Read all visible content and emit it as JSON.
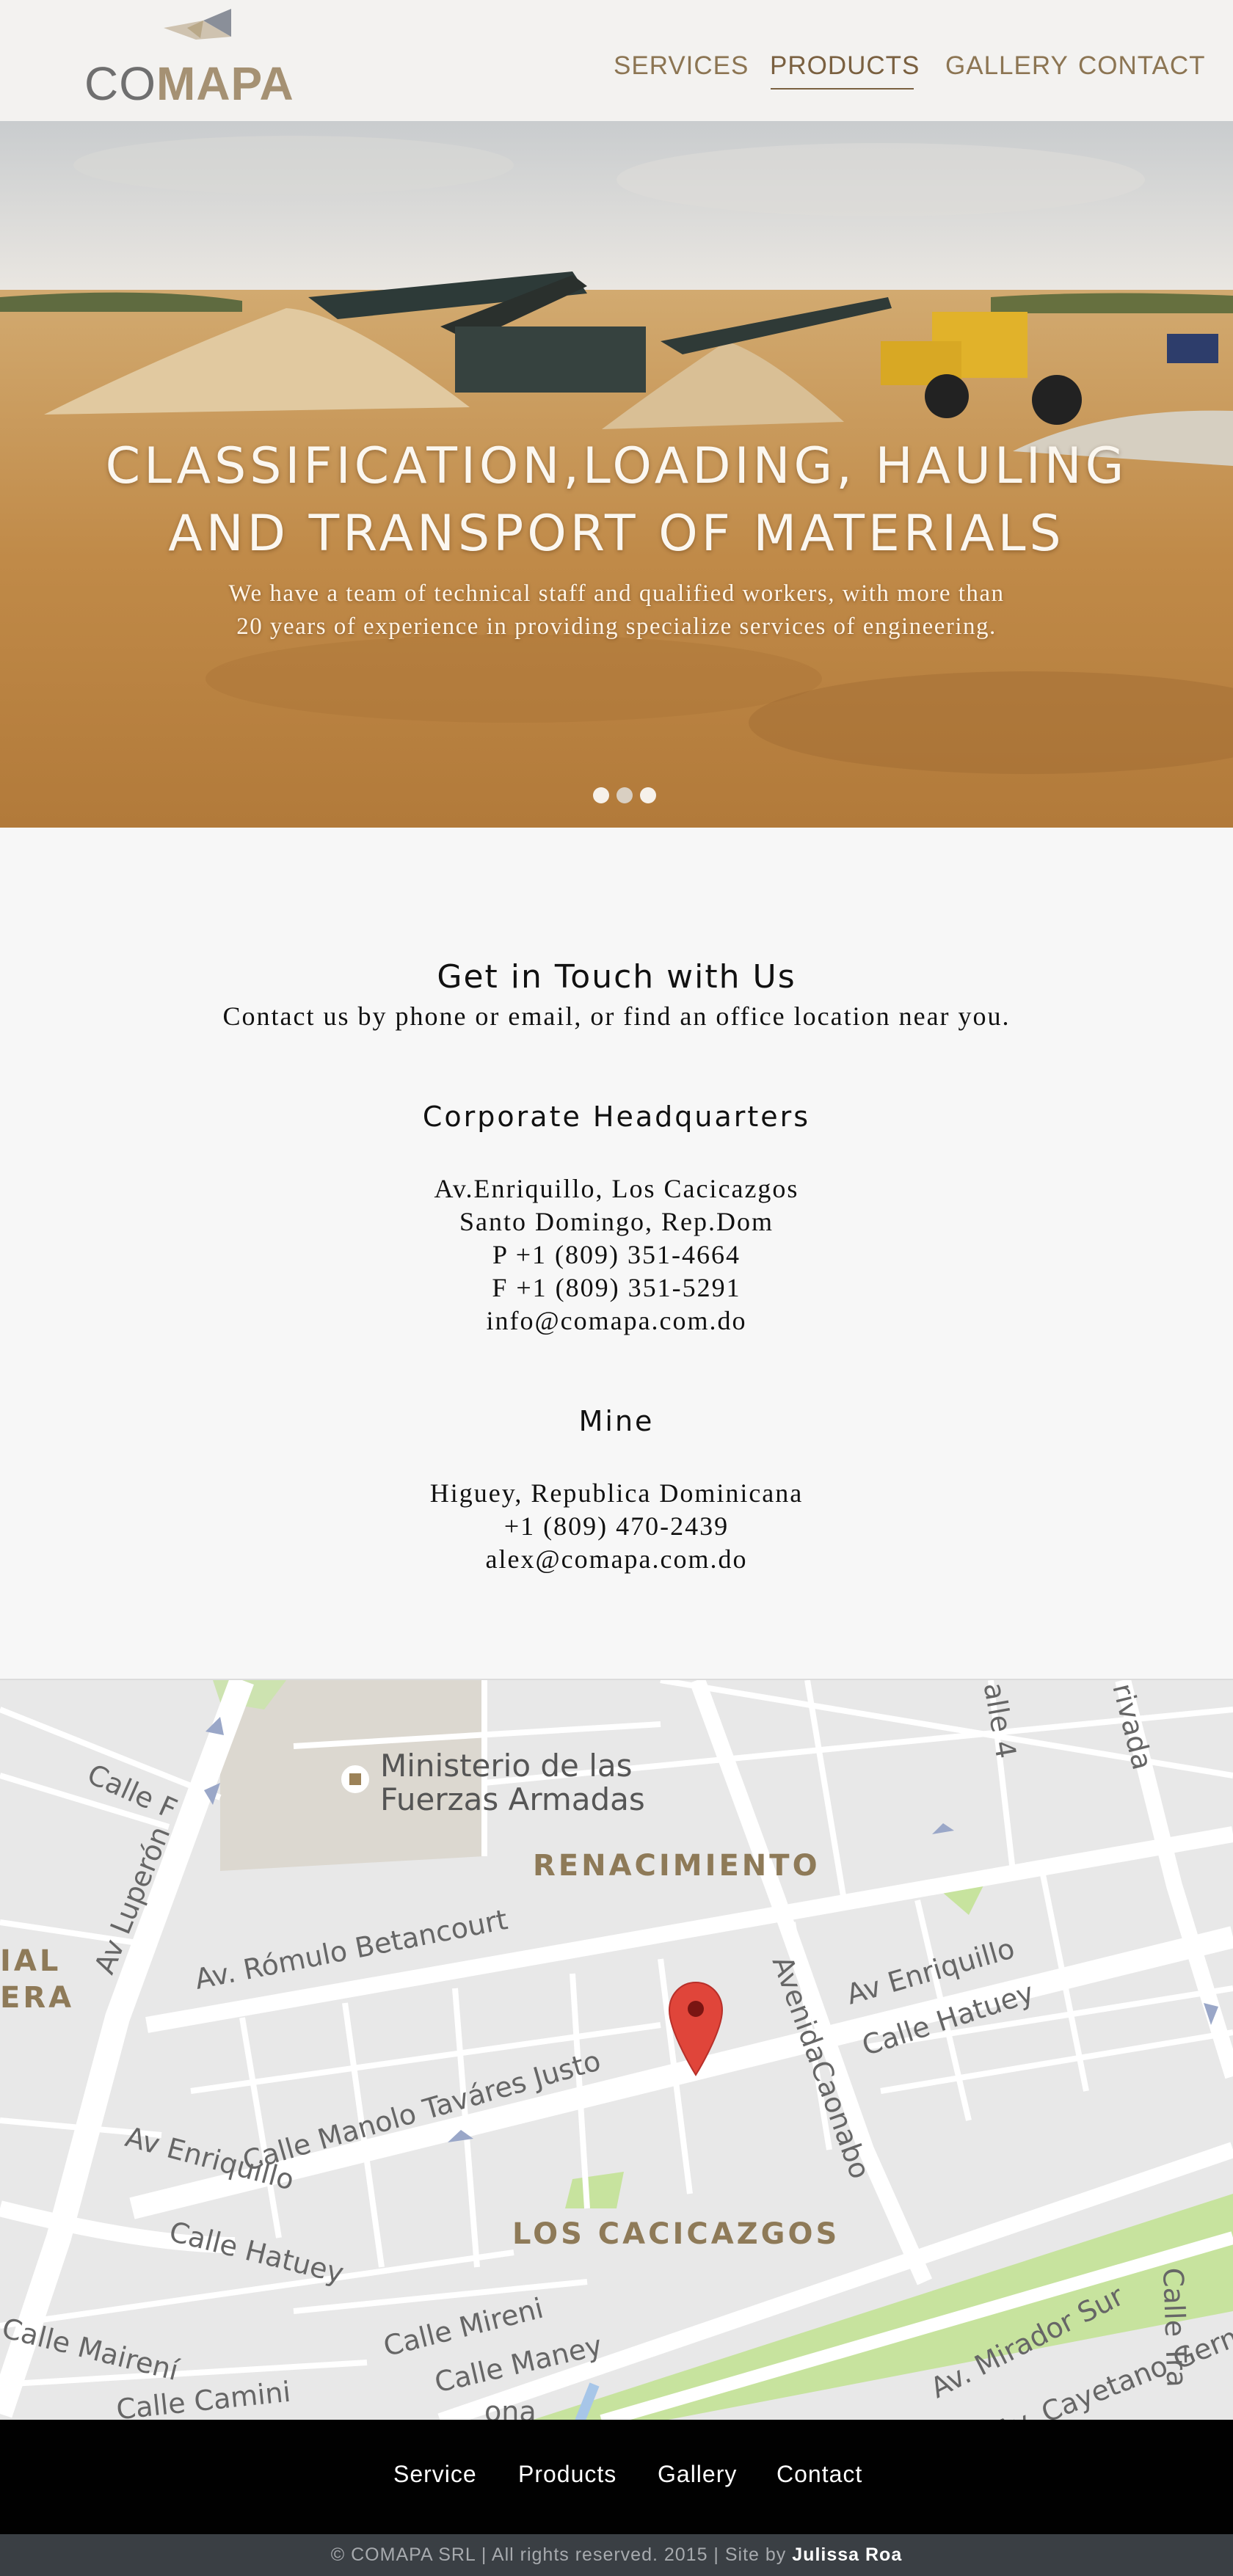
{
  "brand": {
    "logo_part1": "CO",
    "logo_part2": "MAPA",
    "primary_color": "#8c7553",
    "accent_color": "#a59173"
  },
  "nav": {
    "items": [
      {
        "label": "SERVICES"
      },
      {
        "label": "PRODUCTS",
        "active": true
      },
      {
        "label": "GALLERY"
      },
      {
        "label": "CONTACT"
      }
    ]
  },
  "hero": {
    "title_line1": "CLASSIFICATION,LOADING, HAULING",
    "title_line2": "AND TRANSPORT OF MATERIALS",
    "subtitle_line1": "We have a team of technical staff and qualified workers, with more than",
    "subtitle_line2": "20 years of experience in providing specialize services of engineering.",
    "slides_total": 3,
    "active_slide": 1
  },
  "contact": {
    "heading": "Get in Touch with Us",
    "intro": "Contact us by phone or email, or find an office location near you.",
    "hq": {
      "title": "Corporate Headquarters",
      "address_line1": "Av.Enriquillo, Los Cacicazgos",
      "address_line2": "Santo Domingo, Rep.Dom",
      "phone": "P +1 (809) 351-4664",
      "fax": "F +1 (809) 351-5291",
      "email": "info@comapa.com.do"
    },
    "mine": {
      "title": "Mine",
      "address": "Higuey, Republica Dominicana",
      "phone": "+1 (809) 470-2439",
      "email": "alex@comapa.com.do"
    }
  },
  "map": {
    "poi_line1": "Ministerio de las",
    "poi_line2": "Fuerzas Armadas",
    "districts": {
      "renacimiento": "RENACIMIENTO",
      "los_cacicazgos": "LOS CACICAZGOS",
      "partial_1": "IAL",
      "partial_2": "ERA"
    },
    "streets": {
      "calle_f": "Calle F",
      "av_luperon": "Av Luperón",
      "romulo": "Av. Rómulo Betancourt",
      "manolo": "Calle Manolo Taváres Justo",
      "av_enriquillo_left": "Av Enriquillo",
      "av_enriquillo_right": "Av Enriquillo",
      "calle_hatuey_right": "Calle Hatuey",
      "calle_hatuey_left": "Calle Hatuey",
      "caonabo": "AvenidaCaonabo",
      "mireni_left": "Calle Mireni",
      "calle_mairení": "Calle Mairení",
      "calle_maney": "Calle Maney",
      "calle_mairení_left": "Calle Mairení",
      "calle_camini": "Calle Camini",
      "mirador_sur": "Av. Mirador Sur",
      "cayetano": "Av. Cayetano Germ",
      "calle_4": "alle 4",
      "privada": "rivada",
      "calle_tra": "Calle Tra",
      "ona": "ona"
    }
  },
  "footer": {
    "links": [
      "Service",
      "Products",
      "Gallery",
      "Contact"
    ],
    "copyright": "© COMAPA SRL  |  All rights reserved. 2015   |  Site by",
    "author": "Julissa Roa"
  }
}
